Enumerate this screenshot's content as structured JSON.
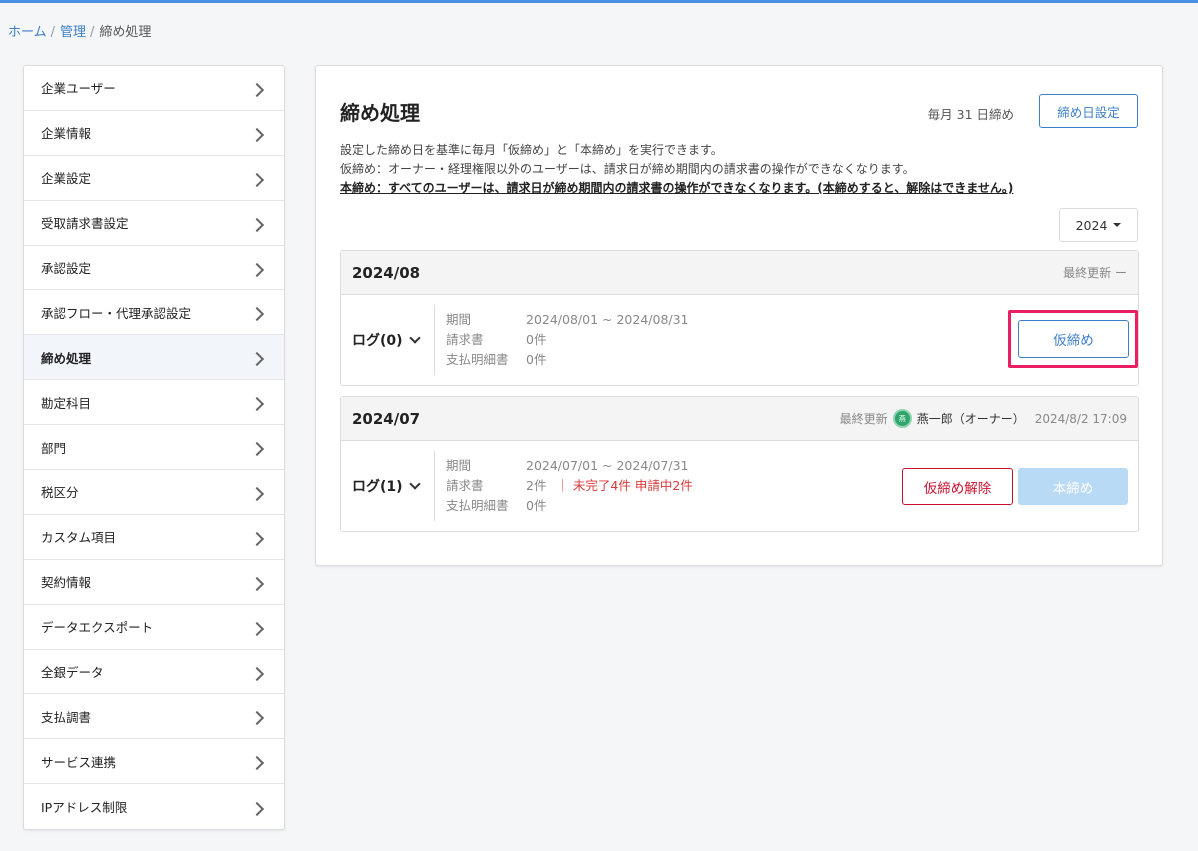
{
  "breadcrumb": {
    "home": "ホーム",
    "admin": "管理",
    "current": "締め処理"
  },
  "sidebar": {
    "items": [
      {
        "label": "企業ユーザー"
      },
      {
        "label": "企業情報"
      },
      {
        "label": "企業設定"
      },
      {
        "label": "受取請求書設定"
      },
      {
        "label": "承認設定"
      },
      {
        "label": "承認フロー・代理承認設定"
      },
      {
        "label": "締め処理"
      },
      {
        "label": "勘定科目"
      },
      {
        "label": "部門"
      },
      {
        "label": "税区分"
      },
      {
        "label": "カスタム項目"
      },
      {
        "label": "契約情報"
      },
      {
        "label": "データエクスポート"
      },
      {
        "label": "全銀データ"
      },
      {
        "label": "支払調書"
      },
      {
        "label": "サービス連携"
      },
      {
        "label": "IPアドレス制限"
      }
    ]
  },
  "main": {
    "title": "締め処理",
    "close_day": "毎月 31 日締め",
    "close_day_button": "締め日設定",
    "desc_line1": "設定した締め日を基準に毎月「仮締め」と「本締め」を実行できます。",
    "desc_line2": "仮締め：オーナー・経理権限以外のユーザーは、請求日が締め期間内の請求書の操作ができなくなります。",
    "desc_line3": "本締め：すべてのユーザーは、請求日が締め期間内の請求書の操作ができなくなります。(本締めすると、解除はできません。)",
    "year": "2024"
  },
  "periods": [
    {
      "month": "2024/08",
      "updated_label": "最終更新 ー",
      "log": "ログ(0)",
      "period_label": "期間",
      "period_value": "2024/08/01 ~ 2024/08/31",
      "invoice_label": "請求書",
      "invoice_value": "0件",
      "statement_label": "支払明細書",
      "statement_value": "0件",
      "action": "仮締め"
    },
    {
      "month": "2024/07",
      "updated_label": "最終更新",
      "updated_avatar": "燕",
      "updated_user": "燕一郎（オーナー）",
      "updated_time": "2024/8/2 17:09",
      "log": "ログ(1)",
      "period_label": "期間",
      "period_value": "2024/07/01 ~ 2024/07/31",
      "invoice_label": "請求書",
      "invoice_value": "2件",
      "invoice_warn": "｜ 未完了4件 申請中2件",
      "statement_label": "支払明細書",
      "statement_value": "0件",
      "action_unprov": "仮締め解除",
      "action_final": "本締め"
    }
  ]
}
